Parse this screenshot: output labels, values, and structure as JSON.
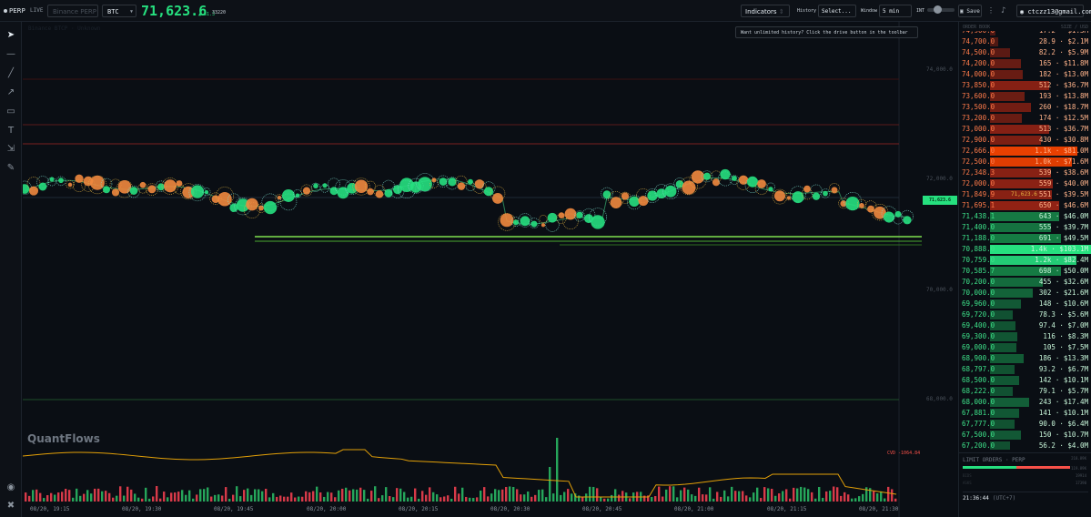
{
  "topbar": {
    "mode": "PERP",
    "live": "LIVE",
    "exchange_placeholder": "Binance PERP",
    "symbol": "BTC",
    "price": "71,623.6",
    "change": "▲ 31.3",
    "count": "33220",
    "indicators": "Indicators",
    "history_label": "History",
    "history_value": "Select...",
    "window_label": "Window",
    "window_value": "5 min",
    "int_label": "INT",
    "save": "Save",
    "user": "ctczz13@gmail.com"
  },
  "chart": {
    "watermark": "Binance BTCP · Unknown",
    "banner": "Want unlimited history? Click the drive button in the toolbar",
    "brand": "QuantFlows",
    "cvd_label": "CVD -1064.84",
    "current_price": "71,623.6",
    "y_labels": [
      "74,000.0",
      "72,000.0",
      "70,000.0",
      "68,000.0"
    ],
    "x_labels": [
      "08/20, 19:15",
      "08/20, 19:30",
      "08/20, 19:45",
      "08/20, 20:00",
      "08/20, 20:15",
      "08/20, 20:30",
      "08/20, 20:45",
      "08/20, 21:00",
      "08/20, 21:15",
      "08/20, 21:30"
    ],
    "colors": {
      "buy": "#26e07f",
      "sell": "#f0883e",
      "cvd": "#e3a008",
      "volume_up": "#26a65b",
      "volume_down": "#d73a49"
    }
  },
  "orderbook": {
    "header_left": "ORDER BOOK",
    "header_right": "SIZE / USD",
    "asks": [
      {
        "price": "74,900.0",
        "qty": "17.2",
        "usd": "$1.3M",
        "w": 0.05
      },
      {
        "price": "74,700.0",
        "qty": "28.9",
        "usd": "$2.1M",
        "w": 0.08
      },
      {
        "price": "74,500.0",
        "qty": "82.2",
        "usd": "$5.9M",
        "w": 0.2
      },
      {
        "price": "74,200.0",
        "qty": "165",
        "usd": "$11.8M",
        "w": 0.3
      },
      {
        "price": "74,000.0",
        "qty": "182",
        "usd": "$13.0M",
        "w": 0.32
      },
      {
        "price": "73,850.0",
        "qty": "512",
        "usd": "$36.7M",
        "w": 0.58
      },
      {
        "price": "73,600.0",
        "qty": "193",
        "usd": "$13.8M",
        "w": 0.34
      },
      {
        "price": "73,500.0",
        "qty": "260",
        "usd": "$18.7M",
        "w": 0.4
      },
      {
        "price": "73,200.0",
        "qty": "174",
        "usd": "$12.5M",
        "w": 0.31
      },
      {
        "price": "73,000.0",
        "qty": "513",
        "usd": "$36.7M",
        "w": 0.58
      },
      {
        "price": "72,900.0",
        "qty": "430",
        "usd": "$30.8M",
        "w": 0.5
      },
      {
        "price": "72,666.0",
        "qty": "1.1k",
        "usd": "$81.0M",
        "w": 0.86
      },
      {
        "price": "72,500.0",
        "qty": "1.0k",
        "usd": "$71.6M",
        "w": 0.8
      },
      {
        "price": "72,348.3",
        "qty": "539",
        "usd": "$38.6M",
        "w": 0.6
      },
      {
        "price": "72,000.0",
        "qty": "559",
        "usd": "$40.0M",
        "w": 0.62
      },
      {
        "price": "71,849.9",
        "qty": "551",
        "usd": "$39.5M",
        "w": 0.61,
        "mid": "71,623.6"
      },
      {
        "price": "71,695.1",
        "qty": "650",
        "usd": "$46.6M",
        "w": 0.68
      }
    ],
    "bids": [
      {
        "price": "71,438.1",
        "qty": "643",
        "usd": "$46.0M",
        "w": 0.68
      },
      {
        "price": "71,400.0",
        "qty": "555",
        "usd": "$39.7M",
        "w": 0.6
      },
      {
        "price": "71,188.0",
        "qty": "691",
        "usd": "$49.5M",
        "w": 0.7
      },
      {
        "price": "70,888.0",
        "qty": "1.4k",
        "usd": "$103.1M",
        "w": 1.0
      },
      {
        "price": "70,759.0",
        "qty": "1.2k",
        "usd": "$82.4M",
        "w": 0.85
      },
      {
        "price": "70,585.7",
        "qty": "698",
        "usd": "$50.0M",
        "w": 0.7
      },
      {
        "price": "70,200.0",
        "qty": "455",
        "usd": "$32.6M",
        "w": 0.52
      },
      {
        "price": "70,000.0",
        "qty": "302",
        "usd": "$21.6M",
        "w": 0.42
      },
      {
        "price": "69,960.0",
        "qty": "148",
        "usd": "$10.6M",
        "w": 0.3
      },
      {
        "price": "69,720.0",
        "qty": "78.3",
        "usd": "$5.6M",
        "w": 0.22
      },
      {
        "price": "69,400.0",
        "qty": "97.4",
        "usd": "$7.0M",
        "w": 0.25
      },
      {
        "price": "69,300.0",
        "qty": "116",
        "usd": "$8.3M",
        "w": 0.27
      },
      {
        "price": "69,000.0",
        "qty": "105",
        "usd": "$7.5M",
        "w": 0.26
      },
      {
        "price": "68,900.0",
        "qty": "186",
        "usd": "$13.3M",
        "w": 0.33
      },
      {
        "price": "68,797.0",
        "qty": "93.2",
        "usd": "$6.7M",
        "w": 0.24
      },
      {
        "price": "68,500.0",
        "qty": "142",
        "usd": "$10.1M",
        "w": 0.29
      },
      {
        "price": "68,222.0",
        "qty": "79.1",
        "usd": "$5.7M",
        "w": 0.22
      },
      {
        "price": "68,000.0",
        "qty": "243",
        "usd": "$17.4M",
        "w": 0.38
      },
      {
        "price": "67,881.0",
        "qty": "141",
        "usd": "$10.1M",
        "w": 0.29
      },
      {
        "price": "67,777.0",
        "qty": "90.0",
        "usd": "$6.4M",
        "w": 0.24
      },
      {
        "price": "67,500.0",
        "qty": "150",
        "usd": "$10.7M",
        "w": 0.3
      },
      {
        "price": "67,200.0",
        "qty": "56.2",
        "usd": "$4.0M",
        "w": 0.2
      }
    ],
    "limit_orders_title": "LIMIT ORDERS · PERP",
    "lo_vals": [
      "218.89K",
      "119.89K",
      "19914",
      "17390"
    ],
    "lo_subs": [
      "BIDS",
      "ASKS"
    ],
    "clock": "21:36:44",
    "timezone": "(UTC+7)"
  }
}
